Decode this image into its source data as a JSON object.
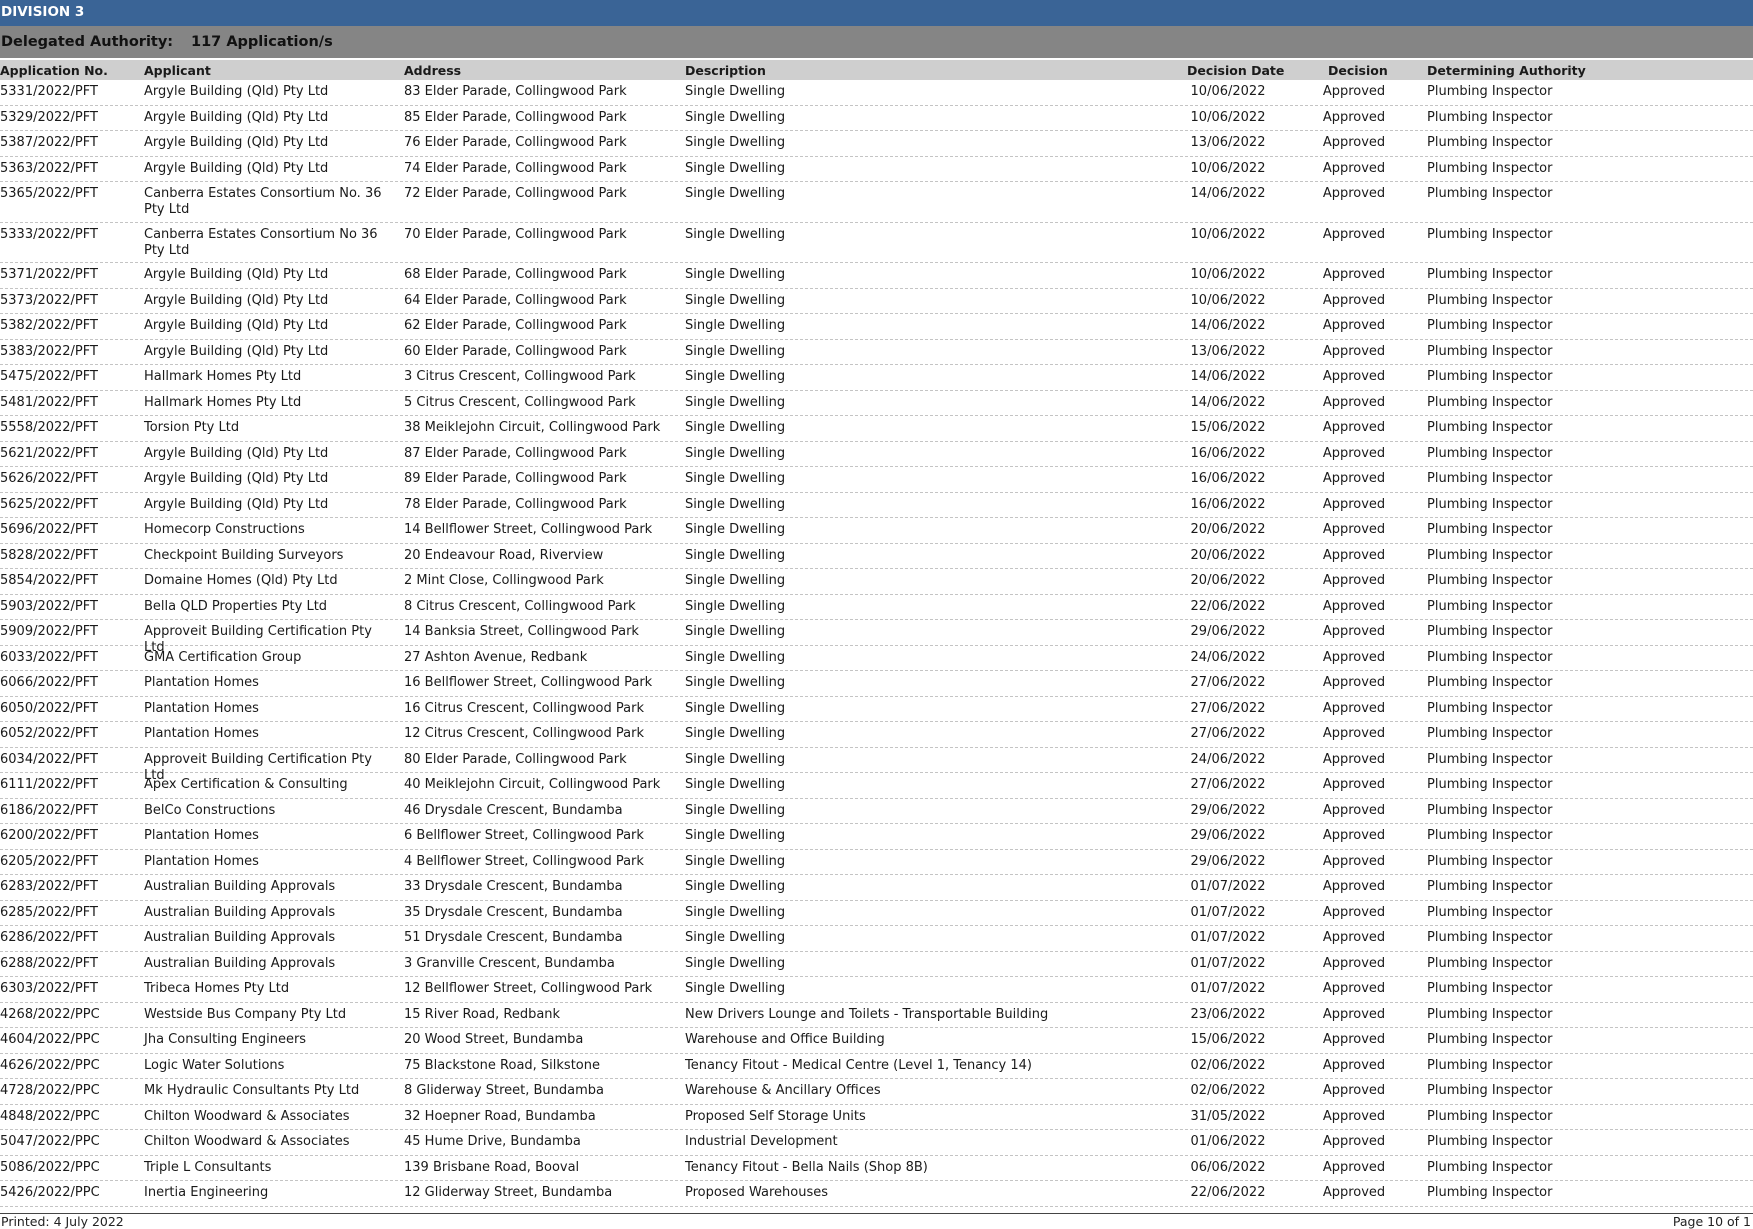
{
  "division": "DIVISION 3",
  "delegated": {
    "label": "Delegated Authority:",
    "count": "117 Application/s"
  },
  "columns": {
    "app_no": "Application No.",
    "applicant": "Applicant",
    "address": "Address",
    "description": "Description",
    "decision_date": "Decision Date",
    "decision": "Decision",
    "authority": "Determining Authority"
  },
  "rows": [
    {
      "app_no": "5331/2022/PFT",
      "applicant": "Argyle Building (Qld) Pty Ltd",
      "address": "83 Elder Parade, Collingwood Park",
      "description": "Single Dwelling",
      "date": "10/06/2022",
      "decision": "Approved",
      "authority": "Plumbing Inspector"
    },
    {
      "app_no": "5329/2022/PFT",
      "applicant": "Argyle Building (Qld) Pty Ltd",
      "address": "85 Elder Parade, Collingwood Park",
      "description": "Single Dwelling",
      "date": "10/06/2022",
      "decision": "Approved",
      "authority": "Plumbing Inspector"
    },
    {
      "app_no": "5387/2022/PFT",
      "applicant": "Argyle Building (Qld) Pty Ltd",
      "address": "76 Elder Parade, Collingwood Park",
      "description": "Single Dwelling",
      "date": "13/06/2022",
      "decision": "Approved",
      "authority": "Plumbing Inspector"
    },
    {
      "app_no": "5363/2022/PFT",
      "applicant": "Argyle Building (Qld) Pty Ltd",
      "address": "74 Elder Parade, Collingwood Park",
      "description": "Single Dwelling",
      "date": "10/06/2022",
      "decision": "Approved",
      "authority": "Plumbing Inspector"
    },
    {
      "app_no": "5365/2022/PFT",
      "applicant": "Canberra Estates Consortium No. 36 Pty Ltd",
      "address": "72 Elder Parade, Collingwood Park",
      "description": "Single Dwelling",
      "date": "14/06/2022",
      "decision": "Approved",
      "authority": "Plumbing Inspector",
      "tall": true
    },
    {
      "app_no": "5333/2022/PFT",
      "applicant": "Canberra Estates Consortium No 36 Pty Ltd",
      "address": "70 Elder Parade, Collingwood Park",
      "description": "Single Dwelling",
      "date": "10/06/2022",
      "decision": "Approved",
      "authority": "Plumbing Inspector",
      "tall": true
    },
    {
      "app_no": "5371/2022/PFT",
      "applicant": "Argyle Building (Qld) Pty Ltd",
      "address": "68 Elder Parade, Collingwood Park",
      "description": "Single Dwelling",
      "date": "10/06/2022",
      "decision": "Approved",
      "authority": "Plumbing Inspector"
    },
    {
      "app_no": "5373/2022/PFT",
      "applicant": "Argyle Building (Qld) Pty Ltd",
      "address": "64 Elder Parade, Collingwood Park",
      "description": "Single Dwelling",
      "date": "10/06/2022",
      "decision": "Approved",
      "authority": "Plumbing Inspector"
    },
    {
      "app_no": "5382/2022/PFT",
      "applicant": "Argyle Building (Qld) Pty Ltd",
      "address": "62 Elder Parade, Collingwood Park",
      "description": "Single Dwelling",
      "date": "14/06/2022",
      "decision": "Approved",
      "authority": "Plumbing Inspector"
    },
    {
      "app_no": "5383/2022/PFT",
      "applicant": "Argyle Building (Qld) Pty Ltd",
      "address": "60 Elder Parade, Collingwood Park",
      "description": "Single Dwelling",
      "date": "13/06/2022",
      "decision": "Approved",
      "authority": "Plumbing Inspector"
    },
    {
      "app_no": "5475/2022/PFT",
      "applicant": "Hallmark Homes Pty Ltd",
      "address": "3 Citrus Crescent, Collingwood Park",
      "description": "Single Dwelling",
      "date": "14/06/2022",
      "decision": "Approved",
      "authority": "Plumbing Inspector"
    },
    {
      "app_no": "5481/2022/PFT",
      "applicant": "Hallmark Homes Pty Ltd",
      "address": "5 Citrus Crescent, Collingwood Park",
      "description": "Single Dwelling",
      "date": "14/06/2022",
      "decision": "Approved",
      "authority": "Plumbing Inspector"
    },
    {
      "app_no": "5558/2022/PFT",
      "applicant": "Torsion Pty Ltd",
      "address": "38 Meiklejohn Circuit, Collingwood Park",
      "description": "Single Dwelling",
      "date": "15/06/2022",
      "decision": "Approved",
      "authority": "Plumbing Inspector"
    },
    {
      "app_no": "5621/2022/PFT",
      "applicant": "Argyle Building (Qld) Pty Ltd",
      "address": "87 Elder Parade, Collingwood Park",
      "description": "Single Dwelling",
      "date": "16/06/2022",
      "decision": "Approved",
      "authority": "Plumbing Inspector"
    },
    {
      "app_no": "5626/2022/PFT",
      "applicant": "Argyle Building (Qld) Pty Ltd",
      "address": "89 Elder Parade, Collingwood Park",
      "description": "Single Dwelling",
      "date": "16/06/2022",
      "decision": "Approved",
      "authority": "Plumbing Inspector"
    },
    {
      "app_no": "5625/2022/PFT",
      "applicant": "Argyle Building (Qld) Pty Ltd",
      "address": "78 Elder Parade, Collingwood Park",
      "description": "Single Dwelling",
      "date": "16/06/2022",
      "decision": "Approved",
      "authority": "Plumbing Inspector"
    },
    {
      "app_no": "5696/2022/PFT",
      "applicant": "Homecorp Constructions",
      "address": "14 Bellflower Street, Collingwood Park",
      "description": "Single Dwelling",
      "date": "20/06/2022",
      "decision": "Approved",
      "authority": "Plumbing Inspector"
    },
    {
      "app_no": "5828/2022/PFT",
      "applicant": "Checkpoint Building Surveyors",
      "address": "20 Endeavour Road, Riverview",
      "description": "Single Dwelling",
      "date": "20/06/2022",
      "decision": "Approved",
      "authority": "Plumbing Inspector"
    },
    {
      "app_no": "5854/2022/PFT",
      "applicant": "Domaine Homes (Qld) Pty Ltd",
      "address": "2 Mint Close, Collingwood Park",
      "description": "Single Dwelling",
      "date": "20/06/2022",
      "decision": "Approved",
      "authority": "Plumbing Inspector"
    },
    {
      "app_no": "5903/2022/PFT",
      "applicant": "Bella QLD Properties Pty Ltd",
      "address": "8 Citrus Crescent, Collingwood Park",
      "description": "Single Dwelling",
      "date": "22/06/2022",
      "decision": "Approved",
      "authority": "Plumbing Inspector"
    },
    {
      "app_no": "5909/2022/PFT",
      "applicant": "Approveit Building Certification Pty Ltd",
      "address": "14 Banksia Street, Collingwood Park",
      "description": "Single Dwelling",
      "date": "29/06/2022",
      "decision": "Approved",
      "authority": "Plumbing Inspector"
    },
    {
      "app_no": "6033/2022/PFT",
      "applicant": "GMA Certification Group",
      "address": "27 Ashton Avenue, Redbank",
      "description": "Single Dwelling",
      "date": "24/06/2022",
      "decision": "Approved",
      "authority": "Plumbing Inspector"
    },
    {
      "app_no": "6066/2022/PFT",
      "applicant": "Plantation Homes",
      "address": "16 Bellflower Street, Collingwood Park",
      "description": "Single Dwelling",
      "date": "27/06/2022",
      "decision": "Approved",
      "authority": "Plumbing Inspector"
    },
    {
      "app_no": "6050/2022/PFT",
      "applicant": "Plantation Homes",
      "address": "16 Citrus Crescent, Collingwood Park",
      "description": "Single Dwelling",
      "date": "27/06/2022",
      "decision": "Approved",
      "authority": "Plumbing Inspector"
    },
    {
      "app_no": "6052/2022/PFT",
      "applicant": "Plantation Homes",
      "address": "12 Citrus Crescent, Collingwood Park",
      "description": "Single Dwelling",
      "date": "27/06/2022",
      "decision": "Approved",
      "authority": "Plumbing Inspector"
    },
    {
      "app_no": "6034/2022/PFT",
      "applicant": "Approveit Building Certification Pty Ltd",
      "address": "80 Elder Parade, Collingwood Park",
      "description": "Single Dwelling",
      "date": "24/06/2022",
      "decision": "Approved",
      "authority": "Plumbing Inspector"
    },
    {
      "app_no": "6111/2022/PFT",
      "applicant": "Apex Certification & Consulting",
      "address": "40 Meiklejohn Circuit, Collingwood Park",
      "description": "Single Dwelling",
      "date": "27/06/2022",
      "decision": "Approved",
      "authority": "Plumbing Inspector"
    },
    {
      "app_no": "6186/2022/PFT",
      "applicant": "BelCo Constructions",
      "address": "46 Drysdale Crescent, Bundamba",
      "description": "Single Dwelling",
      "date": "29/06/2022",
      "decision": "Approved",
      "authority": "Plumbing Inspector"
    },
    {
      "app_no": "6200/2022/PFT",
      "applicant": "Plantation Homes",
      "address": "6 Bellflower Street, Collingwood Park",
      "description": "Single Dwelling",
      "date": "29/06/2022",
      "decision": "Approved",
      "authority": "Plumbing Inspector"
    },
    {
      "app_no": "6205/2022/PFT",
      "applicant": "Plantation Homes",
      "address": "4 Bellflower Street, Collingwood Park",
      "description": "Single Dwelling",
      "date": "29/06/2022",
      "decision": "Approved",
      "authority": "Plumbing Inspector"
    },
    {
      "app_no": "6283/2022/PFT",
      "applicant": "Australian Building Approvals",
      "address": "33 Drysdale Crescent, Bundamba",
      "description": "Single Dwelling",
      "date": "01/07/2022",
      "decision": "Approved",
      "authority": "Plumbing Inspector"
    },
    {
      "app_no": "6285/2022/PFT",
      "applicant": "Australian Building Approvals",
      "address": "35 Drysdale Crescent, Bundamba",
      "description": "Single Dwelling",
      "date": "01/07/2022",
      "decision": "Approved",
      "authority": "Plumbing Inspector"
    },
    {
      "app_no": "6286/2022/PFT",
      "applicant": "Australian Building Approvals",
      "address": "51 Drysdale Crescent, Bundamba",
      "description": "Single Dwelling",
      "date": "01/07/2022",
      "decision": "Approved",
      "authority": "Plumbing Inspector"
    },
    {
      "app_no": "6288/2022/PFT",
      "applicant": "Australian Building Approvals",
      "address": "3 Granville Crescent, Bundamba",
      "description": "Single Dwelling",
      "date": "01/07/2022",
      "decision": "Approved",
      "authority": "Plumbing Inspector"
    },
    {
      "app_no": "6303/2022/PFT",
      "applicant": "Tribeca Homes Pty Ltd",
      "address": "12 Bellflower Street, Collingwood Park",
      "description": "Single Dwelling",
      "date": "01/07/2022",
      "decision": "Approved",
      "authority": "Plumbing Inspector"
    },
    {
      "app_no": "4268/2022/PPC",
      "applicant": "Westside Bus Company Pty Ltd",
      "address": "15 River Road, Redbank",
      "description": "New Drivers Lounge and Toilets - Transportable Building",
      "date": "23/06/2022",
      "decision": "Approved",
      "authority": "Plumbing Inspector"
    },
    {
      "app_no": "4604/2022/PPC",
      "applicant": "Jha Consulting Engineers",
      "address": "20 Wood Street, Bundamba",
      "description": "Warehouse and Office Building",
      "date": "15/06/2022",
      "decision": "Approved",
      "authority": "Plumbing Inspector"
    },
    {
      "app_no": "4626/2022/PPC",
      "applicant": "Logic Water Solutions",
      "address": "75 Blackstone Road, Silkstone",
      "description": "Tenancy Fitout - Medical Centre (Level 1, Tenancy 14)",
      "date": "02/06/2022",
      "decision": "Approved",
      "authority": "Plumbing Inspector"
    },
    {
      "app_no": "4728/2022/PPC",
      "applicant": "Mk Hydraulic Consultants Pty Ltd",
      "address": "8 Gliderway Street, Bundamba",
      "description": "Warehouse & Ancillary Offices",
      "date": "02/06/2022",
      "decision": "Approved",
      "authority": "Plumbing Inspector"
    },
    {
      "app_no": "4848/2022/PPC",
      "applicant": "Chilton Woodward & Associates",
      "address": "32 Hoepner Road, Bundamba",
      "description": "Proposed Self Storage Units",
      "date": "31/05/2022",
      "decision": "Approved",
      "authority": "Plumbing Inspector"
    },
    {
      "app_no": "5047/2022/PPC",
      "applicant": "Chilton Woodward & Associates",
      "address": "45 Hume Drive, Bundamba",
      "description": "Industrial Development",
      "date": "01/06/2022",
      "decision": "Approved",
      "authority": "Plumbing Inspector"
    },
    {
      "app_no": "5086/2022/PPC",
      "applicant": "Triple L Consultants",
      "address": "139 Brisbane Road, Booval",
      "description": "Tenancy Fitout - Bella Nails (Shop 8B)",
      "date": "06/06/2022",
      "decision": "Approved",
      "authority": "Plumbing Inspector"
    },
    {
      "app_no": "5426/2022/PPC",
      "applicant": "Inertia Engineering",
      "address": "12 Gliderway Street, Bundamba",
      "description": "Proposed Warehouses",
      "date": "22/06/2022",
      "decision": "Approved",
      "authority": "Plumbing Inspector"
    }
  ],
  "footer": {
    "printed": "Printed: 4 July 2022",
    "page": "Page 10 of 1"
  }
}
